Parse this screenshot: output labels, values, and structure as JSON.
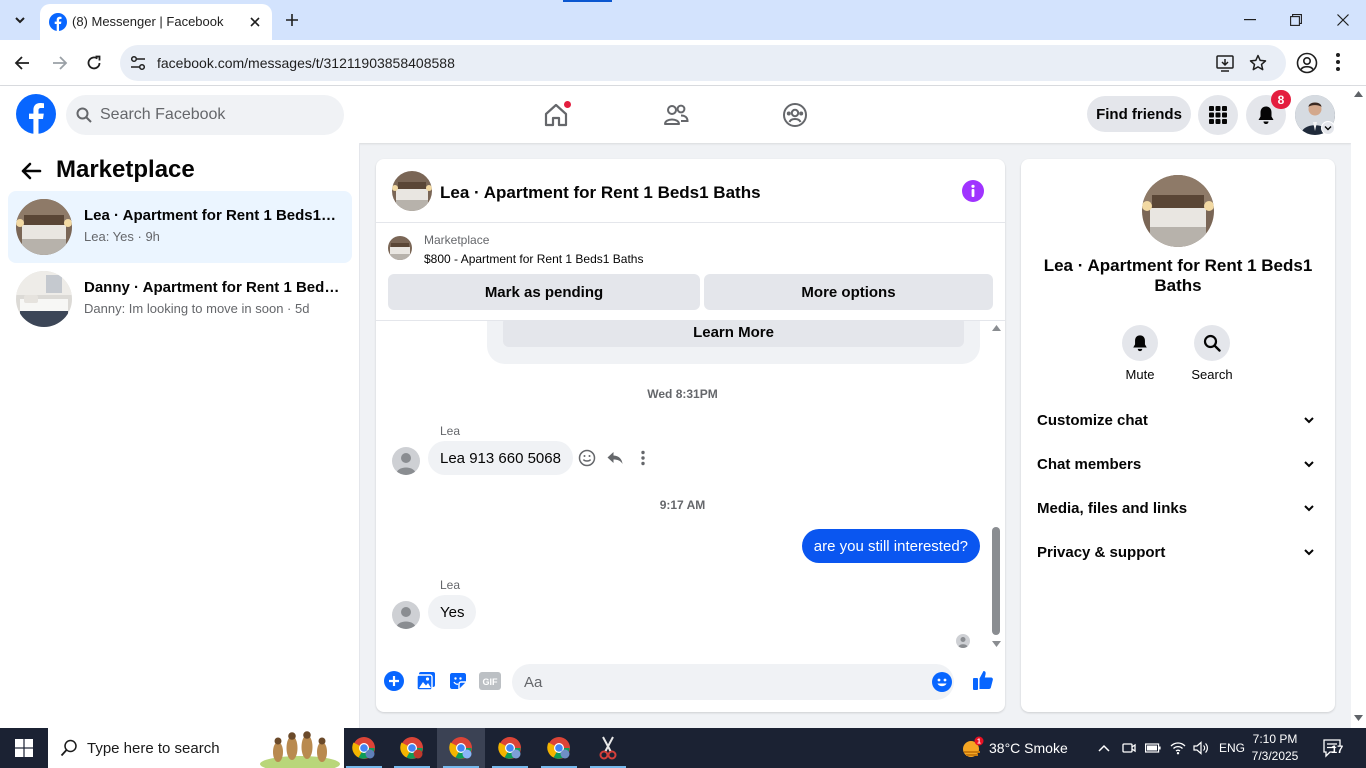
{
  "browser": {
    "tab_title": "(8) Messenger | Facebook",
    "url": "facebook.com/messages/t/31211903858408588"
  },
  "fb_nav": {
    "search_placeholder": "Search Facebook",
    "find_friends": "Find friends",
    "notification_count": "8"
  },
  "left_panel": {
    "title": "Marketplace",
    "conversations": [
      {
        "name": "Lea · Apartment for Rent 1 Beds1 Baths",
        "preview": "Lea: Yes · 9h",
        "active": true
      },
      {
        "name": "Danny · Apartment for Rent 1 Beds1 Baths",
        "preview": "Danny: Im looking to move in soon · 5d",
        "active": false
      }
    ]
  },
  "chat": {
    "title": "Lea · Apartment for Rent 1 Beds1 Baths",
    "listing": {
      "category": "Marketplace",
      "description": "$800 - Apartment for Rent 1 Beds1 Baths",
      "mark_pending": "Mark as pending",
      "more_options": "More options"
    },
    "learn_more": "Learn More",
    "messages": {
      "ts1": "Wed 8:31PM",
      "sender1": "Lea",
      "msg1": "Lea 913 660 5068",
      "ts2": "9:17 AM",
      "msg2": "are you still interested?",
      "sender2": "Lea",
      "msg3": "Yes"
    },
    "composer_placeholder": "Aa"
  },
  "right_panel": {
    "name": "Lea · Apartment for Rent 1 Beds1 Baths",
    "mute": "Mute",
    "search": "Search",
    "sections": [
      "Customize chat",
      "Chat members",
      "Media, files and links",
      "Privacy & support"
    ]
  },
  "taskbar": {
    "search_placeholder": "Type here to search",
    "weather": "38°C  Smoke",
    "language": "ENG",
    "time": "7:10 PM",
    "date": "7/3/2025",
    "notif_count": "17"
  },
  "colors": {
    "fb_blue": "#0866ff",
    "messenger_purple": "#a033ff",
    "outgoing_bubble": "#0a56f0"
  }
}
